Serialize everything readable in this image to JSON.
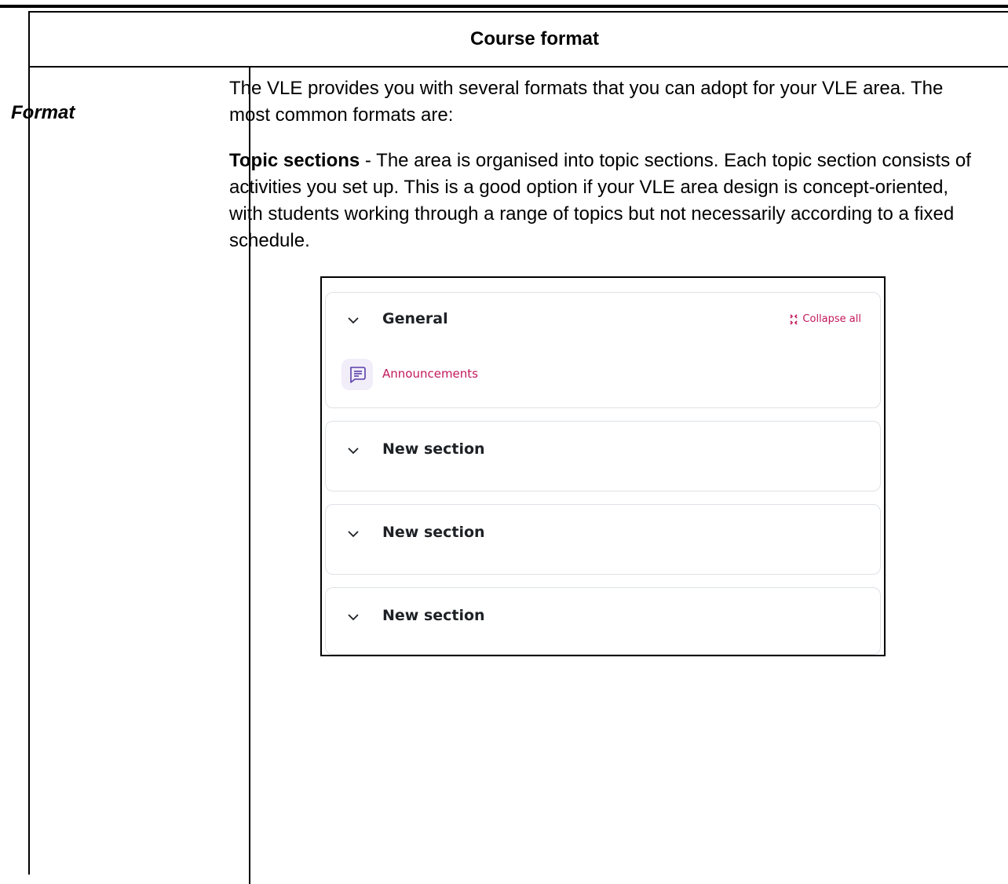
{
  "table": {
    "header": "Course format",
    "row_label": "Format"
  },
  "content": {
    "intro": "The VLE provides you with several formats that you can adopt for your VLE area. The most common formats are:",
    "topic_term": "Topic sections",
    "topic_desc": " - The area is organised into topic sections. Each topic section consists of activities you set up. This is a good option if your VLE area design is concept-oriented, with students working through a range of topics but not necessarily according to a fixed schedule."
  },
  "screenshot": {
    "collapse_all": "Collapse all",
    "sections": [
      {
        "title": "General",
        "activity": "Announcements"
      },
      {
        "title": "New section"
      },
      {
        "title": "New section"
      },
      {
        "title": "New section"
      }
    ],
    "colors": {
      "accent": "#c2185b",
      "icon_bg": "#f1edf9",
      "icon_stroke": "#5b3fa8",
      "border": "#dee2e6"
    }
  }
}
